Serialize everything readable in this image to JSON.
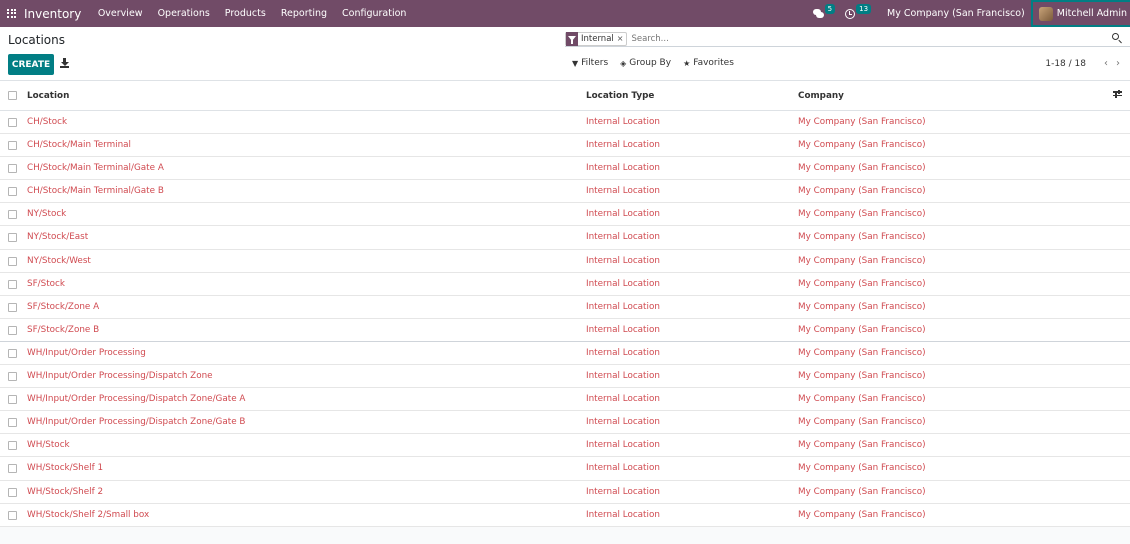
{
  "navbar": {
    "app_name": "Inventory",
    "menu": [
      "Overview",
      "Operations",
      "Products",
      "Reporting",
      "Configuration"
    ],
    "chat_count": "5",
    "activity_count": "13",
    "company": "My Company (San Francisco)",
    "user": "Mitchell Admin"
  },
  "control_panel": {
    "title": "Locations",
    "create_label": "CREATE",
    "facet_label": "Internal",
    "facet_close": "×",
    "search_placeholder": "Search...",
    "filters_label": "Filters",
    "groupby_label": "Group By",
    "favorites_label": "Favorites",
    "pager": "1-18 / 18"
  },
  "table": {
    "headers": {
      "location": "Location",
      "type": "Location Type",
      "company": "Company"
    },
    "rows": [
      {
        "location": "CH/Stock",
        "type": "Internal Location",
        "company": "My Company (San Francisco)"
      },
      {
        "location": "CH/Stock/Main Terminal",
        "type": "Internal Location",
        "company": "My Company (San Francisco)"
      },
      {
        "location": "CH/Stock/Main Terminal/Gate A",
        "type": "Internal Location",
        "company": "My Company (San Francisco)"
      },
      {
        "location": "CH/Stock/Main Terminal/Gate B",
        "type": "Internal Location",
        "company": "My Company (San Francisco)"
      },
      {
        "location": "NY/Stock",
        "type": "Internal Location",
        "company": "My Company (San Francisco)"
      },
      {
        "location": "NY/Stock/East",
        "type": "Internal Location",
        "company": "My Company (San Francisco)"
      },
      {
        "location": "NY/Stock/West",
        "type": "Internal Location",
        "company": "My Company (San Francisco)"
      },
      {
        "location": "SF/Stock",
        "type": "Internal Location",
        "company": "My Company (San Francisco)"
      },
      {
        "location": "SF/Stock/Zone A",
        "type": "Internal Location",
        "company": "My Company (San Francisco)"
      },
      {
        "location": "SF/Stock/Zone B",
        "type": "Internal Location",
        "company": "My Company (San Francisco)"
      },
      {
        "location": "WH/Input/Order Processing",
        "type": "Internal Location",
        "company": "My Company (San Francisco)"
      },
      {
        "location": "WH/Input/Order Processing/Dispatch Zone",
        "type": "Internal Location",
        "company": "My Company (San Francisco)"
      },
      {
        "location": "WH/Input/Order Processing/Dispatch Zone/Gate A",
        "type": "Internal Location",
        "company": "My Company (San Francisco)"
      },
      {
        "location": "WH/Input/Order Processing/Dispatch Zone/Gate B",
        "type": "Internal Location",
        "company": "My Company (San Francisco)"
      },
      {
        "location": "WH/Stock",
        "type": "Internal Location",
        "company": "My Company (San Francisco)"
      },
      {
        "location": "WH/Stock/Shelf 1",
        "type": "Internal Location",
        "company": "My Company (San Francisco)"
      },
      {
        "location": "WH/Stock/Shelf 2",
        "type": "Internal Location",
        "company": "My Company (San Francisco)"
      },
      {
        "location": "WH/Stock/Shelf 2/Small box",
        "type": "Internal Location",
        "company": "My Company (San Francisco)"
      }
    ]
  },
  "colors": {
    "brand": "#714b67",
    "accent": "#017e84",
    "link": "#d04a50"
  }
}
